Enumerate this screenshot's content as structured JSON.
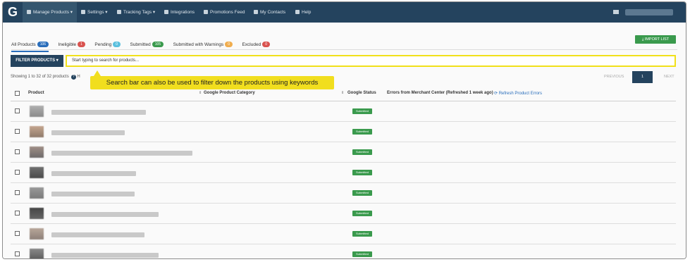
{
  "nav": {
    "logo": "G",
    "items": [
      {
        "label": "Manage Products ▾",
        "icon": "list-icon",
        "active": true
      },
      {
        "label": "Settings ▾",
        "icon": "gear-icon"
      },
      {
        "label": "Tracking Tags ▾",
        "icon": "chart-icon"
      },
      {
        "label": "Integrations",
        "icon": "store-icon"
      },
      {
        "label": "Promotions Feed",
        "icon": "promo-icon"
      },
      {
        "label": "My Contacts",
        "icon": "contacts-icon"
      },
      {
        "label": "Help",
        "icon": "help-icon"
      }
    ]
  },
  "tabs": [
    {
      "label": "All Products",
      "count": "106",
      "color": "#2a6ebb",
      "active": true
    },
    {
      "label": "Ineligible",
      "count": "1",
      "color": "#d9534f"
    },
    {
      "label": "Pending",
      "count": "0",
      "color": "#5bc0de"
    },
    {
      "label": "Submitted",
      "count": "105",
      "color": "#3a9a4d"
    },
    {
      "label": "Submitted with Warnings",
      "count": "0",
      "color": "#f0ad4e"
    },
    {
      "label": "Excluded",
      "count": "0",
      "color": "#d9534f"
    }
  ],
  "import_button": "IMPORT LIST",
  "filter_button": "FILTER PRODUCTS ▾",
  "search": {
    "placeholder": "Start typing to search for products..."
  },
  "showing_text": "Showing 1 to 32 of 32 products",
  "help_mark": "?",
  "help_letter": "H",
  "pager": {
    "previous": "PREVIOUS",
    "current": "1",
    "next": "NEXT"
  },
  "callout": "Search bar can also be used to filter down the products using keywords",
  "table": {
    "headers": {
      "product": "Product",
      "category": "Google Product Category",
      "status": "Google Status",
      "errors": "Errors from Merchant Center (Refreshed 1 week ago)",
      "refresh": "⟳ Refresh Product Errors"
    },
    "rows": [
      {
        "status": "Submitted"
      },
      {
        "status": "Submitted"
      },
      {
        "status": "Submitted"
      },
      {
        "status": "Submitted"
      },
      {
        "status": "Submitted"
      },
      {
        "status": "Submitted"
      },
      {
        "status": "Submitted"
      },
      {
        "status": "Submitted"
      }
    ]
  },
  "colors": {
    "navbar": "#24435e",
    "accent": "#2a6ebb",
    "success": "#3a9a4d",
    "highlight": "#f1de1e"
  }
}
